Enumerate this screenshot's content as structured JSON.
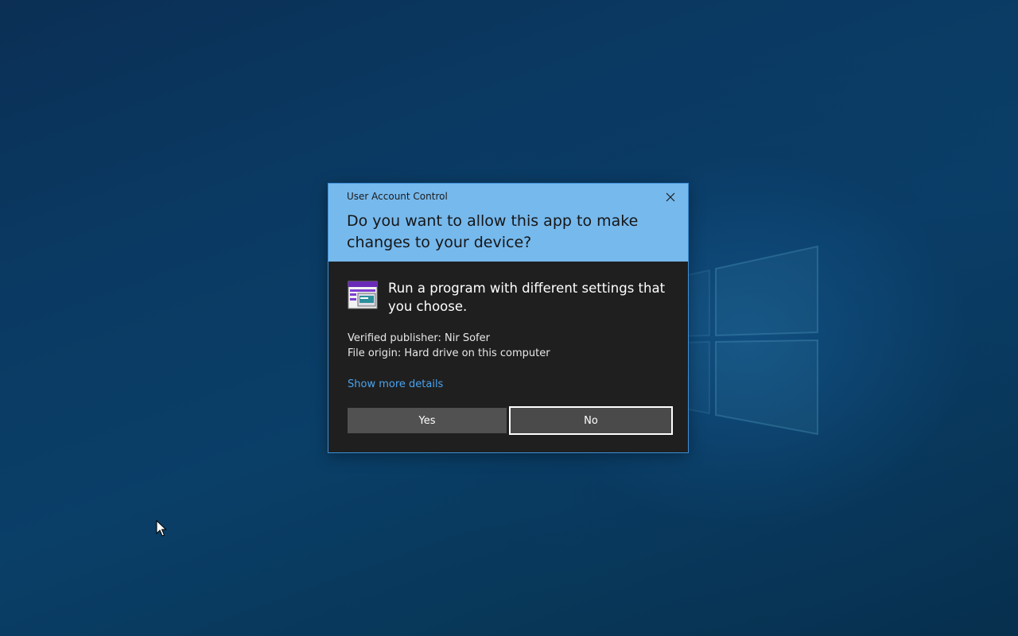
{
  "desktop": {
    "accent": "#0a3f68"
  },
  "dialog": {
    "title": "User Account Control",
    "question": "Do you want to allow this app to make changes to your device?",
    "app_description": "Run a program with different settings that you choose.",
    "publisher": "Verified publisher: Nir Sofer",
    "file_origin": "File origin: Hard drive on this computer",
    "details_link": "Show more details",
    "yes_label": "Yes",
    "no_label": "No",
    "header_color": "#76b9ed",
    "body_color": "#1f1f1f",
    "link_color": "#4ba3ee",
    "icons": {
      "close": "close-icon",
      "app": "program-window-icon"
    }
  }
}
